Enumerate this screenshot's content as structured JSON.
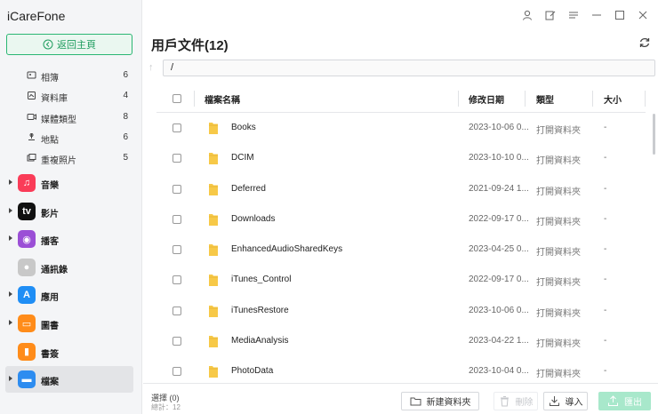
{
  "app": {
    "title": "iCareFone"
  },
  "sidebar": {
    "back_label": "返回主頁",
    "sub_items": [
      {
        "label": "相簿",
        "count": "6",
        "icon": "photo-album-icon"
      },
      {
        "label": "資料庫",
        "count": "4",
        "icon": "library-icon"
      },
      {
        "label": "媒體類型",
        "count": "8",
        "icon": "media-type-icon"
      },
      {
        "label": "地點",
        "count": "6",
        "icon": "location-icon"
      },
      {
        "label": "重複照片",
        "count": "5",
        "icon": "duplicate-photos-icon"
      }
    ],
    "categories": [
      {
        "label": "音樂",
        "icon": "music-icon",
        "glyph": "♫",
        "color": "#fa3c58",
        "has_arrow": true
      },
      {
        "label": "影片",
        "icon": "apple-tv-icon",
        "glyph": "tv",
        "color": "#111111",
        "has_arrow": true
      },
      {
        "label": "播客",
        "icon": "podcast-icon",
        "glyph": "◉",
        "color": "#9b4fd6",
        "has_arrow": true
      },
      {
        "label": "通訊錄",
        "icon": "contacts-icon",
        "glyph": "●",
        "color": "#c8c8c8",
        "has_arrow": false
      },
      {
        "label": "應用",
        "icon": "app-store-icon",
        "glyph": "A",
        "color": "#1f8ef5",
        "has_arrow": true
      },
      {
        "label": "圖書",
        "icon": "books-icon",
        "glyph": "▭",
        "color": "#ff8c1a",
        "has_arrow": true
      },
      {
        "label": "書簽",
        "icon": "bookmark-icon",
        "glyph": "▮",
        "color": "#ff8c1a",
        "has_arrow": false
      },
      {
        "label": "檔案",
        "icon": "files-icon",
        "glyph": "▬",
        "color": "#2d8cf0",
        "has_arrow": true,
        "active": true
      }
    ]
  },
  "header": {
    "title": "用戶文件(12)",
    "path": "/"
  },
  "table": {
    "columns": [
      "檔案名稱",
      "修改日期",
      "類型",
      "大小"
    ],
    "rows": [
      {
        "name": "Books",
        "date": "2023-10-06 0...",
        "type": "打開資料夾",
        "size": "-"
      },
      {
        "name": "DCIM",
        "date": "2023-10-10 0...",
        "type": "打開資料夾",
        "size": "-"
      },
      {
        "name": "Deferred",
        "date": "2021-09-24 1...",
        "type": "打開資料夾",
        "size": "-"
      },
      {
        "name": "Downloads",
        "date": "2022-09-17 0...",
        "type": "打開資料夾",
        "size": "-"
      },
      {
        "name": "EnhancedAudioSharedKeys",
        "date": "2023-04-25 0...",
        "type": "打開資料夾",
        "size": "-"
      },
      {
        "name": "iTunes_Control",
        "date": "2022-09-17 0...",
        "type": "打開資料夾",
        "size": "-"
      },
      {
        "name": "iTunesRestore",
        "date": "2023-10-06 0...",
        "type": "打開資料夾",
        "size": "-"
      },
      {
        "name": "MediaAnalysis",
        "date": "2023-04-22 1...",
        "type": "打開資料夾",
        "size": "-"
      },
      {
        "name": "PhotoData",
        "date": "2023-10-04 0...",
        "type": "打開資料夾",
        "size": "-"
      }
    ]
  },
  "footer": {
    "selected": "選擇 (0)",
    "total": "總計：12",
    "new_folder": "新建資料夾",
    "delete": "刪除",
    "import": "導入",
    "export": "匯出"
  },
  "colors": {
    "accent": "#2bb673",
    "folder": "#f7c948"
  }
}
